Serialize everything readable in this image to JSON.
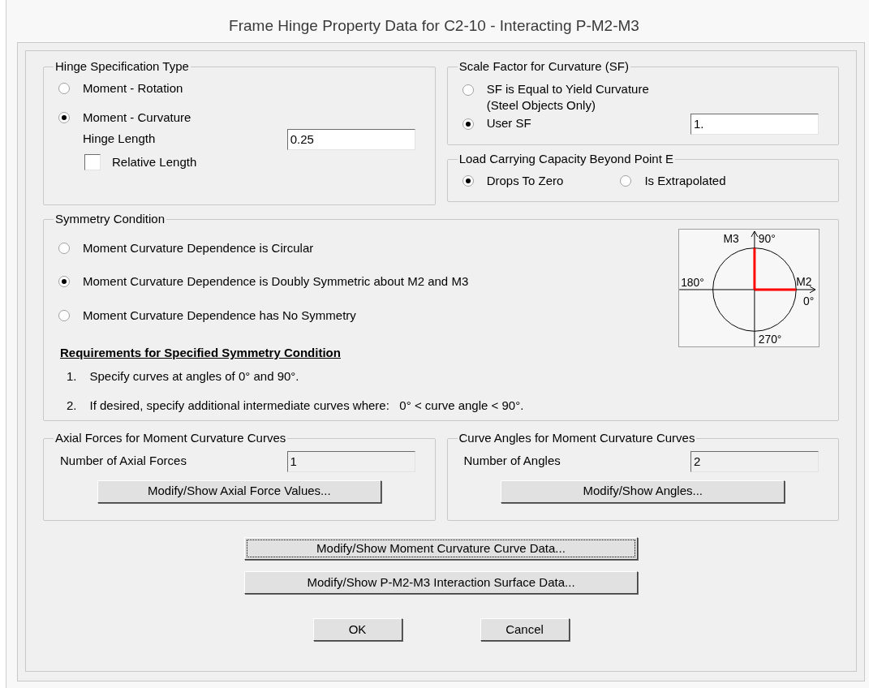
{
  "window": {
    "title": "Frame Hinge Property Data for C2-10 - Interacting P-M2-M3"
  },
  "hinge_specification": {
    "title": "Hinge Specification Type",
    "options": [
      {
        "label": "Moment - Rotation",
        "selected": false
      },
      {
        "label": "Moment - Curvature",
        "selected": true
      }
    ],
    "hinge_length": {
      "label": "Hinge Length",
      "value": "0.25",
      "read_only": false
    },
    "relative_length": {
      "label": "Relative Length",
      "checked": false
    }
  },
  "scale_factor": {
    "title": "Scale Factor for Curvature (SF)",
    "options": [
      {
        "label": "SF is Equal to Yield Curvature",
        "note": "(Steel Objects Only)",
        "selected": false
      },
      {
        "label": "User SF",
        "value": "1.",
        "selected": true
      }
    ]
  },
  "load_capacity": {
    "title": "Load Carrying Capacity Beyond Point E",
    "options": [
      {
        "label": "Drops To Zero",
        "selected": true
      },
      {
        "label": "Is Extrapolated",
        "selected": false
      }
    ]
  },
  "symmetry": {
    "title": "Symmetry Condition",
    "options": [
      {
        "label": "Moment Curvature Dependence is Circular",
        "selected": false
      },
      {
        "label": "Moment Curvature Dependence is Doubly Symmetric about M2 and M3",
        "selected": true
      },
      {
        "label": "Moment Curvature Dependence has No Symmetry",
        "selected": false
      }
    ],
    "diagram": {
      "m3": "M3",
      "top_angle": "90°",
      "left_angle": "180°",
      "m2": "M2",
      "right_angle": "0°",
      "bottom_angle": "270°"
    },
    "requirements": {
      "heading": "Requirements for Specified Symmetry Condition",
      "items": [
        {
          "number": "1.",
          "text": "Specify curves at angles of 0° and 90°."
        },
        {
          "number": "2.",
          "text": "If desired, specify additional intermediate curves where:   0° < curve angle < 90°."
        }
      ]
    }
  },
  "axial_forces": {
    "title": "Axial Forces for Moment Curvature Curves",
    "field": {
      "label": "Number of Axial Forces",
      "value": "1",
      "read_only": true
    },
    "button": "Modify/Show Axial Force Values..."
  },
  "curve_angles": {
    "title": "Curve Angles for Moment Curvature Curves",
    "field": {
      "label": "Number of Angles",
      "value": "2",
      "read_only": true
    },
    "button": "Modify/Show Angles..."
  },
  "buttons": [
    {
      "label": "Modify/Show Moment Curvature Curve Data...",
      "focused": true
    },
    {
      "label": "Modify/Show P-M2-M3 Interaction Surface Data...",
      "focused": false
    }
  ],
  "dialog_buttons": [
    {
      "label": "OK",
      "focused": false
    },
    {
      "label": "Cancel",
      "focused": false
    }
  ]
}
